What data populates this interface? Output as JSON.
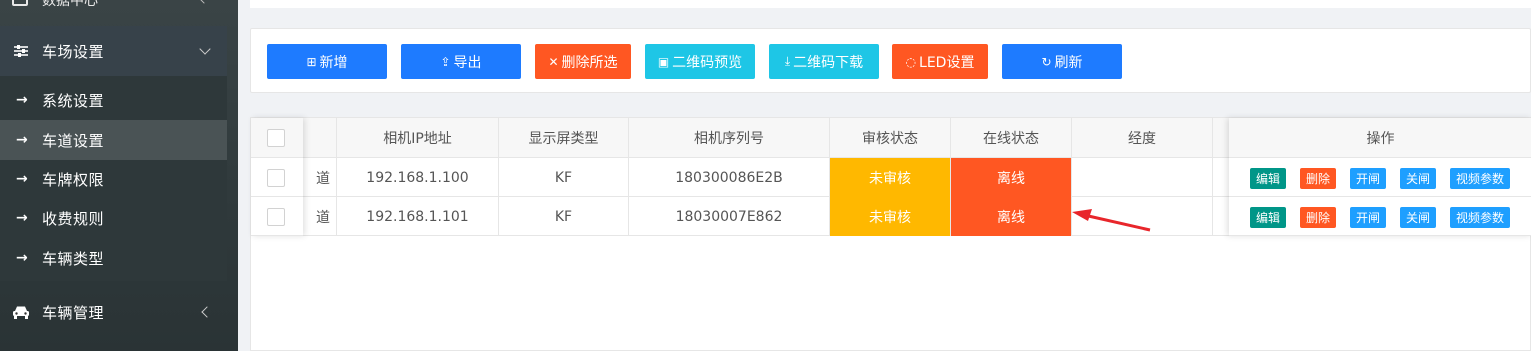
{
  "sidebar": {
    "top_item": {
      "label": "数据中心"
    },
    "groups": [
      {
        "label": "车场设置",
        "icon": "sliders-icon"
      },
      {
        "label": "车辆管理",
        "icon": "car-icon"
      }
    ],
    "submenu": [
      {
        "label": "系统设置"
      },
      {
        "label": "车道设置",
        "active": true
      },
      {
        "label": "车牌权限"
      },
      {
        "label": "收费规则"
      },
      {
        "label": "车辆类型"
      }
    ],
    "arrow": "→"
  },
  "toolbar": {
    "buttons": [
      {
        "label": "新增",
        "icon": "⊞",
        "color": "#1e7bff"
      },
      {
        "label": "导出",
        "icon": "⇪",
        "color": "#1e7bff"
      },
      {
        "label": "删除所选",
        "icon": "✕",
        "color": "#ff5722"
      },
      {
        "label": "二维码预览",
        "icon": "▣",
        "color": "#1ec6e6"
      },
      {
        "label": "二维码下载",
        "icon": "⤓",
        "color": "#1ec6e6"
      },
      {
        "label": "LED设置",
        "icon": "◌",
        "color": "#ff5722"
      },
      {
        "label": "刷新",
        "icon": "↻",
        "color": "#1e7bff"
      }
    ]
  },
  "table": {
    "columns": [
      "相机IP地址",
      "显示屏类型",
      "相机序列号",
      "审核状态",
      "在线状态",
      "经度",
      "操作"
    ],
    "clipped_first_col_char": "道",
    "rows": [
      {
        "ip": "192.168.1.100",
        "screen": "KF",
        "serial": "180300086E2B",
        "audit": "未审核",
        "online": "离线"
      },
      {
        "ip": "192.168.1.101",
        "screen": "KF",
        "serial": "18030007E862",
        "audit": "未审核",
        "online": "离线"
      }
    ],
    "actions": [
      {
        "label": "编辑",
        "color": "#009688"
      },
      {
        "label": "删除",
        "color": "#ff5722"
      },
      {
        "label": "开闸",
        "color": "#1e9fff"
      },
      {
        "label": "关闸",
        "color": "#1e9fff"
      },
      {
        "label": "视频参数",
        "color": "#1e9fff"
      }
    ]
  },
  "colors": {
    "audit_pending": "#ffb800",
    "offline": "#ff5722",
    "annotation_arrow": "#e8262b"
  }
}
